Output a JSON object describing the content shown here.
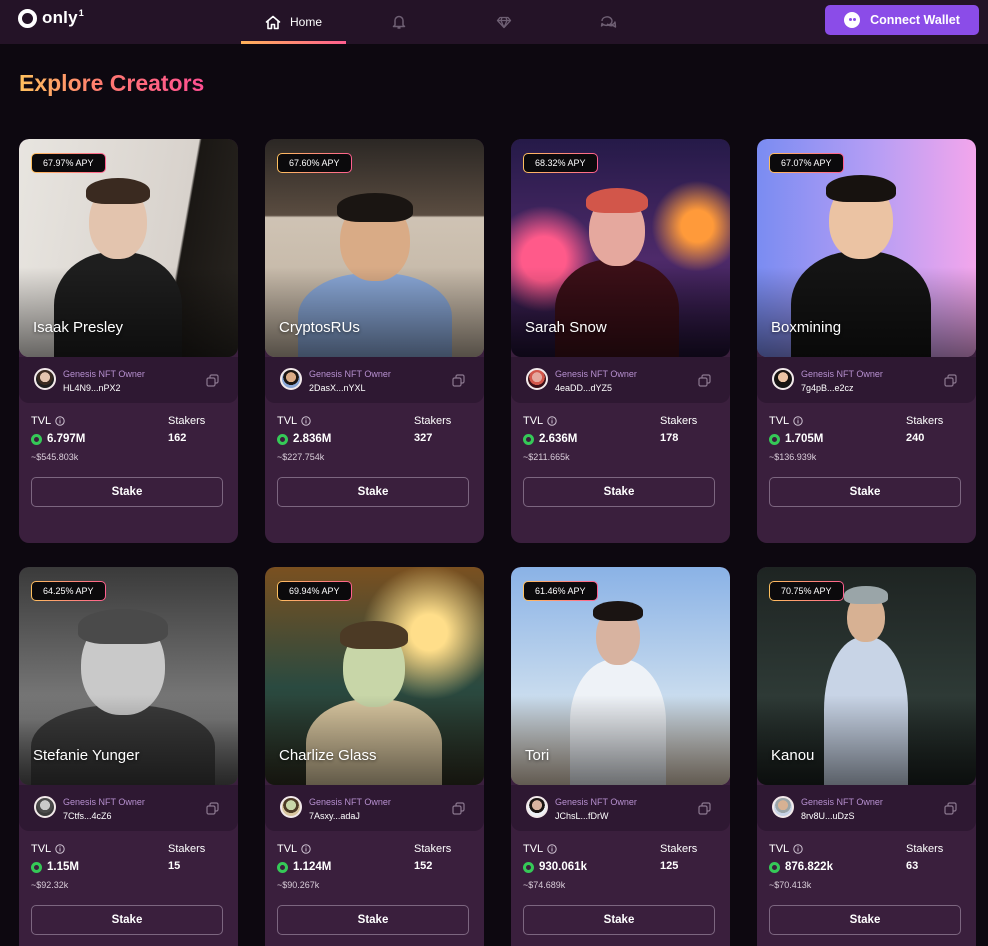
{
  "app": {
    "logo_text": "only",
    "logo_sup": "1"
  },
  "nav": {
    "items": [
      {
        "label": "Home",
        "icon": "home-icon",
        "active": true
      },
      {
        "label": "",
        "icon": "bell-icon",
        "active": false
      },
      {
        "label": "",
        "icon": "diamond-icon",
        "active": false
      },
      {
        "label": "",
        "icon": "chat-icon",
        "active": false
      }
    ]
  },
  "wallet": {
    "label": "Connect Wallet"
  },
  "page": {
    "title": "Explore Creators"
  },
  "card_labels": {
    "owner_label": "Genesis NFT Owner",
    "tvl_label": "TVL",
    "stakers_label": "Stakers",
    "stake_button": "Stake"
  },
  "colors": {
    "accent_purple": "#8b4ce8",
    "title_gradient_start": "#ffc15e",
    "title_gradient_end": "#ff4f92",
    "tvl_ring": "#35c957",
    "card_bg": "#3a1f3d"
  },
  "creators": [
    {
      "name": "Isaak Presley",
      "apy": "67.97% APY",
      "address": "HL4N9...nPX2",
      "tvl": "6.797M",
      "tvl_usd": "~$545.803k",
      "stakers": "162"
    },
    {
      "name": "CryptosRUs",
      "apy": "67.60% APY",
      "address": "2DasX...nYXL",
      "tvl": "2.836M",
      "tvl_usd": "~$227.754k",
      "stakers": "327"
    },
    {
      "name": "Sarah Snow",
      "apy": "68.32% APY",
      "address": "4eaDD...dYZ5",
      "tvl": "2.636M",
      "tvl_usd": "~$211.665k",
      "stakers": "178"
    },
    {
      "name": "Boxmining",
      "apy": "67.07% APY",
      "address": "7g4pB...e2cz",
      "tvl": "1.705M",
      "tvl_usd": "~$136.939k",
      "stakers": "240"
    },
    {
      "name": "Stefanie Yunger",
      "apy": "64.25% APY",
      "address": "7Ctfs...4cZ6",
      "tvl": "1.15M",
      "tvl_usd": "~$92.32k",
      "stakers": "15"
    },
    {
      "name": "Charlize Glass",
      "apy": "69.94% APY",
      "address": "7Asxy...adaJ",
      "tvl": "1.124M",
      "tvl_usd": "~$90.267k",
      "stakers": "152"
    },
    {
      "name": "Tori",
      "apy": "61.46% APY",
      "address": "JChsL...fDrW",
      "tvl": "930.061k",
      "tvl_usd": "~$74.689k",
      "stakers": "125"
    },
    {
      "name": "Kanou",
      "apy": "70.75% APY",
      "address": "8rv8U...uDzS",
      "tvl": "876.822k",
      "tvl_usd": "~$70.413k",
      "stakers": "63"
    }
  ]
}
